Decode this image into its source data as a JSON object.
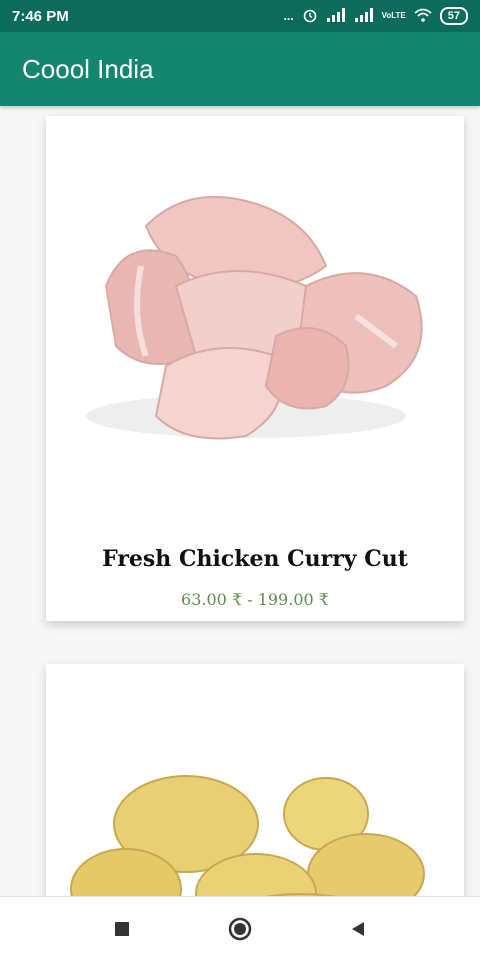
{
  "status": {
    "time": "7:46 PM",
    "overflow": "...",
    "network_label": "VoLTE",
    "battery": "57"
  },
  "app": {
    "title": "Coool India"
  },
  "products": [
    {
      "name": "Fresh Chicken Curry Cut",
      "price": "63.00 ₹ - 199.00 ₹",
      "image_icon": "chicken-curry-cut-photo"
    },
    {
      "name": "",
      "price": "",
      "image_icon": "potatoes-photo"
    }
  ],
  "colors": {
    "appbar": "#14856f",
    "statusbar": "#0d6b5b",
    "price": "#5b8f48"
  },
  "nav": {
    "recents_icon": "square-icon",
    "home_icon": "circle-icon",
    "back_icon": "triangle-left-icon"
  }
}
